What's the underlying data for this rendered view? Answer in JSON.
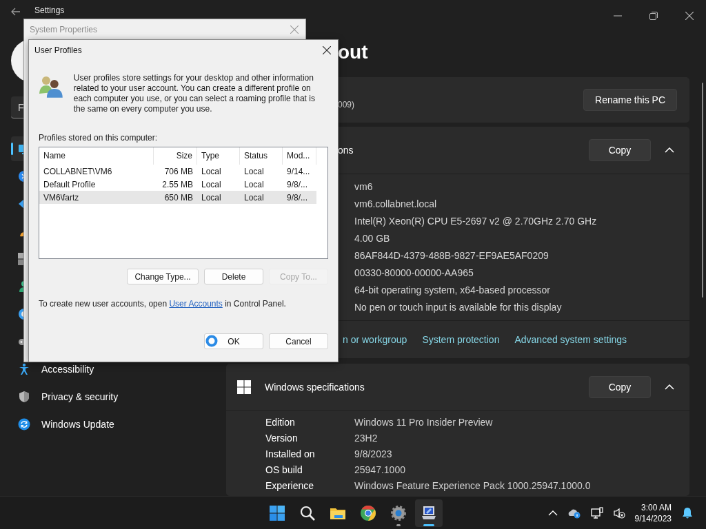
{
  "settings_window": {
    "title": "Settings"
  },
  "sidebar": {
    "search": {
      "placeholder": "F"
    },
    "items": [
      {
        "kind": "system",
        "selected": true
      },
      {
        "kind": "bluetooth",
        "selected": false
      },
      {
        "kind": "network",
        "selected": false
      },
      {
        "kind": "personalization",
        "selected": false
      },
      {
        "kind": "apps",
        "selected": false
      },
      {
        "kind": "accounts",
        "selected": false
      },
      {
        "kind": "time",
        "selected": false
      },
      {
        "kind": "gaming",
        "selected": false
      },
      {
        "kind": "accessibility",
        "label": "Accessibility",
        "selected": false
      },
      {
        "kind": "privacy",
        "label": "Privacy & security",
        "selected": false
      },
      {
        "kind": "update",
        "label": "Windows Update",
        "selected": false
      }
    ]
  },
  "content": {
    "heading": "out",
    "device_card": {
      "text": "009)",
      "button": "Rename this PC"
    },
    "device_specs": {
      "title": "ons",
      "copy": "Copy",
      "expanded": true,
      "values": [
        "vm6",
        "vm6.collabnet.local",
        "Intel(R) Xeon(R) CPU E5-2697 v2 @ 2.70GHz   2.70 GHz",
        "4.00 GB",
        "86AF844D-4379-488B-9827-EF9AE5AF0209",
        "00330-80000-00000-AA965",
        "64-bit operating system, x64-based processor",
        "No pen or touch input is available for this display"
      ]
    },
    "related_links": [
      "n or workgroup",
      "System protection",
      "Advanced system settings"
    ],
    "windows_specs": {
      "title": "Windows specifications",
      "copy": "Copy",
      "expanded": true,
      "rows": [
        {
          "label": "Edition",
          "value": "Windows 11 Pro Insider Preview"
        },
        {
          "label": "Version",
          "value": "23H2"
        },
        {
          "label": "Installed on",
          "value": "9/8/2023"
        },
        {
          "label": "OS build",
          "value": "25947.1000"
        },
        {
          "label": "Experience",
          "value": "Windows Feature Experience Pack 1000.25947.1000.0"
        }
      ]
    }
  },
  "system_properties": {
    "title": "System Properties",
    "active": false
  },
  "user_profiles": {
    "title": "User Profiles",
    "active": true,
    "intro": "User profiles store settings for your desktop and other information related to your user account. You can create a different profile on each computer you use, or you can select a roaming profile that is the same on every computer you use.",
    "list_label": "Profiles stored on this computer:",
    "columns": [
      {
        "label": "Name",
        "kind": "text"
      },
      {
        "label": "Size",
        "kind": "number"
      },
      {
        "label": "Type",
        "kind": "text"
      },
      {
        "label": "Status",
        "kind": "text"
      },
      {
        "label": "Mod...",
        "kind": "text"
      }
    ],
    "rows": [
      {
        "cells": [
          "COLLABNET\\VM6",
          "706 MB",
          "Local",
          "Local",
          "9/14..."
        ],
        "selected": false
      },
      {
        "cells": [
          "Default Profile",
          "2.55 MB",
          "Local",
          "Local",
          "9/8/..."
        ],
        "selected": false
      },
      {
        "cells": [
          "VM6\\fartz",
          "650 MB",
          "Local",
          "Local",
          "9/8/..."
        ],
        "selected": true
      }
    ],
    "buttons": [
      {
        "label": "Change Type...",
        "disabled": false
      },
      {
        "label": "Delete",
        "disabled": false
      },
      {
        "label": "Copy To...",
        "disabled": true
      }
    ],
    "note": {
      "before": "To create new user accounts, open ",
      "link": "User Accounts",
      "after": " in Control Panel."
    },
    "footer_buttons": [
      {
        "label": "OK",
        "disabled": false
      },
      {
        "label": "Cancel",
        "disabled": false
      }
    ]
  },
  "taskbar": {
    "apps": [
      {
        "kind": "start",
        "running": false,
        "active": false
      },
      {
        "kind": "search",
        "running": false,
        "active": false
      },
      {
        "kind": "folder",
        "running": false,
        "active": false
      },
      {
        "kind": "browser",
        "running": false,
        "active": false
      },
      {
        "kind": "gear",
        "running": true,
        "active": false
      },
      {
        "kind": "computer",
        "running": true,
        "active": true
      }
    ],
    "tray": [
      {
        "kind": "chevron"
      },
      {
        "kind": "cloud"
      },
      {
        "kind": "network"
      },
      {
        "kind": "speaker-muted"
      }
    ],
    "clock": {
      "time": "3:00 AM",
      "date": "9/14/2023"
    }
  }
}
